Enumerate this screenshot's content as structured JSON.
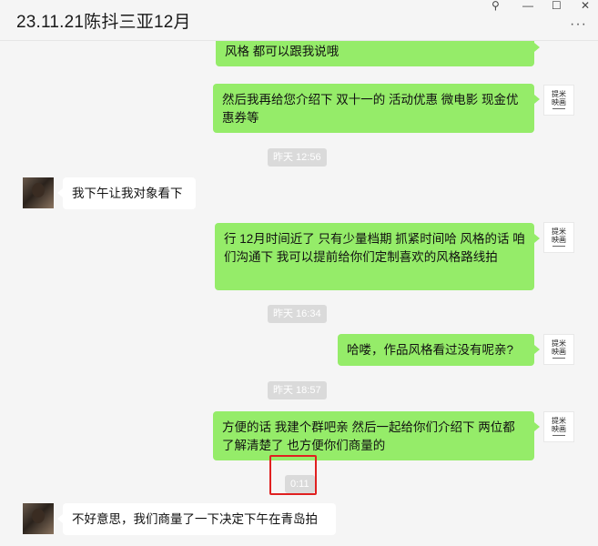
{
  "window": {
    "title": "23.11.21陈抖三亚12月",
    "pin_icon": "⚲",
    "minimize_icon": "—",
    "maximize_icon": "☐",
    "close_icon": "✕",
    "more_icon": "···"
  },
  "avatar_out": {
    "line1": "提米",
    "line2": "映画"
  },
  "messages": [
    {
      "text": "风格 都可以跟我说哦"
    },
    {
      "text": "然后我再给您介绍下 双十一的 活动优惠  微电影  现金优惠券等"
    },
    {
      "time": "昨天 12:56"
    },
    {
      "text": "我下午让我对象看下"
    },
    {
      "text": "行 12月时间近了  只有少量档期   抓紧时间哈   风格的话 咱们沟通下 我可以提前给你们定制喜欢的风格路线拍"
    },
    {
      "time": "昨天 16:34"
    },
    {
      "text": "哈喽，作品风格看过没有呢亲?"
    },
    {
      "time": "昨天 18:57"
    },
    {
      "text": "方便的话  我建个群吧亲  然后一起给你们介绍下  两位都了解清楚了 也方便你们商量的"
    },
    {
      "time": "0:11"
    },
    {
      "text": "不好意思，我们商量了一下决定下午在青岛拍"
    }
  ]
}
